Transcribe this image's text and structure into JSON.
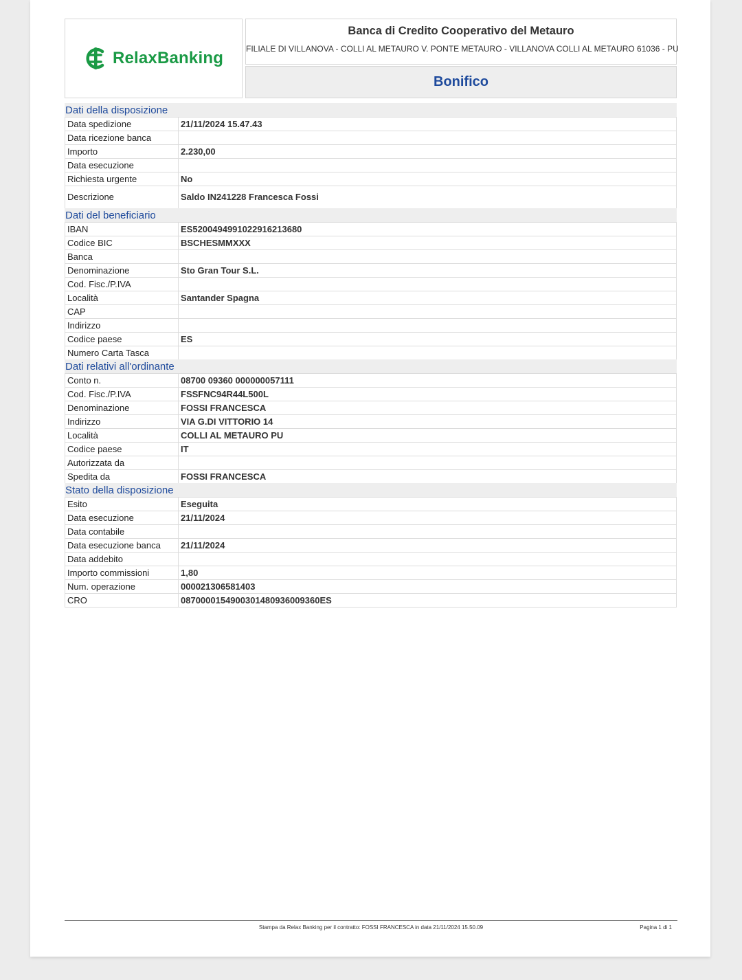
{
  "header": {
    "logo_text": "RelaxBanking",
    "bank_name": "Banca di Credito Cooperativo del Metauro",
    "bank_address": "FILIALE DI VILLANOVA - COLLI AL METAURO V. PONTE METAURO - VILLANOVA COLLI AL METAURO 61036 - PU",
    "doc_title": "Bonifico"
  },
  "colors": {
    "brand_green": "#1a9a45",
    "accent_blue": "#1e4a9c"
  },
  "sections": [
    {
      "title": "Dati della disposizione",
      "rows": [
        {
          "label": "Data spedizione",
          "value": "21/11/2024 15.47.43"
        },
        {
          "label": "Data ricezione banca",
          "value": ""
        },
        {
          "label": "Importo",
          "value": "2.230,00"
        },
        {
          "label": "Data esecuzione",
          "value": ""
        },
        {
          "label": "Richiesta urgente",
          "value": "No"
        },
        {
          "label": "Descrizione",
          "value": "Saldo IN241228 Francesca Fossi"
        }
      ]
    },
    {
      "title": "Dati del beneficiario",
      "rows": [
        {
          "label": "IBAN",
          "value": "ES5200494991022916213680"
        },
        {
          "label": "Codice BIC",
          "value": "BSCHESMMXXX"
        },
        {
          "label": "Banca",
          "value": ""
        },
        {
          "label": "Denominazione",
          "value": "Sto Gran Tour S.L."
        },
        {
          "label": "Cod. Fisc./P.IVA",
          "value": ""
        },
        {
          "label": "Località",
          "value": "Santander Spagna"
        },
        {
          "label": "CAP",
          "value": ""
        },
        {
          "label": "Indirizzo",
          "value": ""
        },
        {
          "label": "Codice paese",
          "value": "ES"
        },
        {
          "label": "Numero Carta Tasca",
          "value": ""
        }
      ]
    },
    {
      "title": "Dati relativi all'ordinante",
      "rows": [
        {
          "label": "Conto n.",
          "value": "08700 09360 000000057111"
        },
        {
          "label": "Cod. Fisc./P.IVA",
          "value": "FSSFNC94R44L500L"
        },
        {
          "label": "Denominazione",
          "value": "FOSSI FRANCESCA"
        },
        {
          "label": "Indirizzo",
          "value": "VIA G.DI VITTORIO 14"
        },
        {
          "label": "Località",
          "value": "COLLI AL METAURO PU"
        },
        {
          "label": "Codice paese",
          "value": "IT"
        },
        {
          "label": "Autorizzata da",
          "value": ""
        },
        {
          "label": "Spedita da",
          "value": "FOSSI FRANCESCA"
        }
      ]
    },
    {
      "title": "Stato della disposizione",
      "rows": [
        {
          "label": "Esito",
          "value": "Eseguita"
        },
        {
          "label": "Data esecuzione",
          "value": "21/11/2024"
        },
        {
          "label": "Data contabile",
          "value": ""
        },
        {
          "label": "Data esecuzione banca",
          "value": "21/11/2024"
        },
        {
          "label": "Data addebito",
          "value": ""
        },
        {
          "label": "Importo commissioni",
          "value": "1,80"
        },
        {
          "label": "Num. operazione",
          "value": "000021306581403"
        },
        {
          "label": "CRO",
          "value": "0870000154900301480936009360ES"
        }
      ]
    }
  ],
  "footer": {
    "print_note": "Stampa da Relax Banking per il contratto: FOSSI FRANCESCA in data 21/11/2024 15.50.09",
    "page_label": "Pagina 1 di   1"
  }
}
